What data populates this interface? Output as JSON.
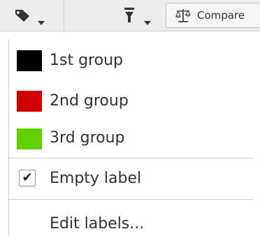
{
  "toolbar": {
    "label_icon": "tag-icon",
    "filter_icon": "filter-icon",
    "compare_icon": "balance-scale-icon",
    "compare_label": "Compare"
  },
  "menu": {
    "groups": [
      {
        "label": "1st group",
        "color": "#000000"
      },
      {
        "label": "2nd group",
        "color": "#d00000"
      },
      {
        "label": "3rd group",
        "color": "#5fd000"
      }
    ],
    "empty_label": {
      "label": "Empty label",
      "checked": true,
      "check_glyph": "✔"
    },
    "edit_labels": "Edit labels..."
  }
}
